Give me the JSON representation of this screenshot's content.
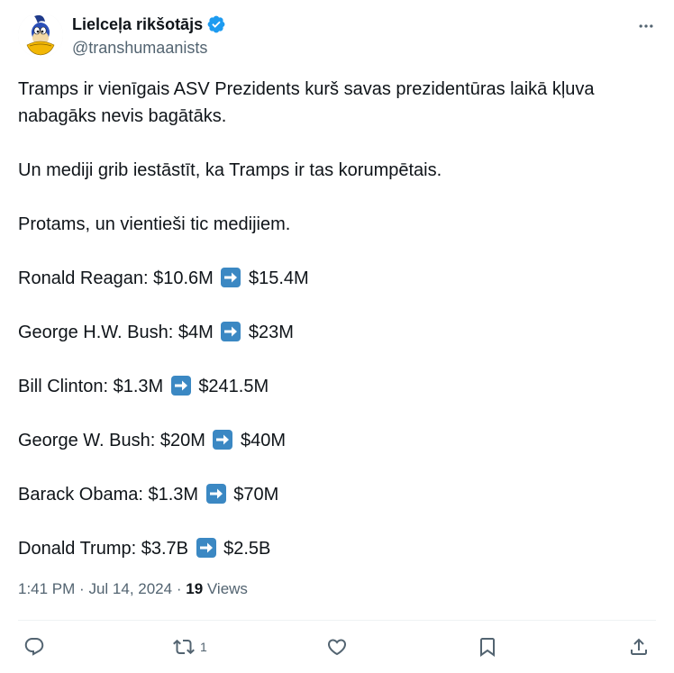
{
  "author": {
    "display_name": "Lielceļa rikšotājs",
    "handle": "@transhumaanists",
    "verified": true,
    "avatar_icon": "road-runner-cartoon-avatar"
  },
  "tweet": {
    "paragraphs": [
      "Tramps ir vienīgais ASV Prezidents kurš savas prezidentūras laikā kļuva nabagāks nevis bagātāks.",
      "Un mediji grib iestāstīt, ka Tramps ir tas korumpētais.",
      "Protams, un vientieši tic medijiem."
    ],
    "net_worth": [
      {
        "name": "Ronald Reagan: $10.6M",
        "after": "$15.4M"
      },
      {
        "name": "George H.W. Bush: $4M",
        "after": "$23M"
      },
      {
        "name": "Bill Clinton: $1.3M",
        "after": "$241.5M"
      },
      {
        "name": "George W. Bush: $20M",
        "after": "$40M"
      },
      {
        "name": "Barack Obama: $1.3M",
        "after": "$70M"
      },
      {
        "name": "Donald Trump: $3.7B",
        "after": "$2.5B"
      }
    ],
    "arrow_icon": "right-arrow-emoji"
  },
  "meta": {
    "time": "1:41 PM",
    "separator": "·",
    "date": "Jul 14, 2024",
    "views_count": "19",
    "views_label": "Views"
  },
  "actions": {
    "reply": {
      "icon": "reply-icon",
      "count": ""
    },
    "retweet": {
      "icon": "retweet-icon",
      "count": "1"
    },
    "like": {
      "icon": "heart-icon",
      "count": ""
    },
    "bookmark": {
      "icon": "bookmark-icon",
      "count": ""
    },
    "share": {
      "icon": "share-icon",
      "count": ""
    }
  },
  "colors": {
    "text": "#0f1419",
    "secondary": "#536471",
    "verified": "#1d9bf0",
    "arrow_emoji_bg": "#3b88c3"
  }
}
